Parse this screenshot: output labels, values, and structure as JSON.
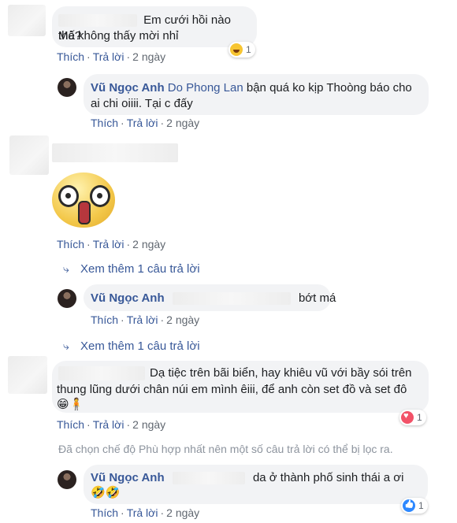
{
  "labels": {
    "like": "Thích",
    "reply": "Trả lời",
    "sep": "·"
  },
  "see_more": [
    "Xem thêm 1 câu trả lời",
    "Xem thêm 1 câu trả lời"
  ],
  "comments": [
    {
      "lines": [
        "Em cưới hồi nào thế?",
        "Mà không thấy mời nhỉ"
      ],
      "time": "2 ngày",
      "reaction": {
        "type": "haha",
        "count": "1"
      }
    },
    {
      "author": "Vũ Ngọc Anh",
      "tag": "Do Phong Lan",
      "text1": "bận quá ko kịp Thoòng báo cho",
      "text2": "ai chi oiiii. Tại c đấy",
      "time": "2 ngày"
    },
    {
      "sticker": "shocked-face-sticker",
      "time": "2 ngày"
    },
    {
      "author": "Vũ Ngọc Anh",
      "text": "bớt má",
      "time": "2 ngày"
    },
    {
      "text1": "Dạ tiệc trên bãi biển, hay khiêu vũ với bầy sói trên",
      "text2": "thung lũng dưới chân núi em mình êiii, để anh còn set đồ và set đô",
      "text3": "😁🧍",
      "time": "2 ngày",
      "reaction": {
        "type": "love",
        "count": "1"
      }
    },
    {
      "author": "Vũ Ngọc Anh",
      "text1": "da ở thành phố sinh thái a ơi",
      "text2": "🤣🤣",
      "time": "2 ngày",
      "reaction": {
        "type": "like",
        "count": "1"
      }
    }
  ],
  "filter_note": "Đã chọn chế độ Phù hợp nhất nên một số câu trả lời có thể bị lọc ra.",
  "colors": {
    "link": "#385898",
    "bubble": "#f2f3f5",
    "muted": "#606770",
    "note": "#8d949e"
  }
}
